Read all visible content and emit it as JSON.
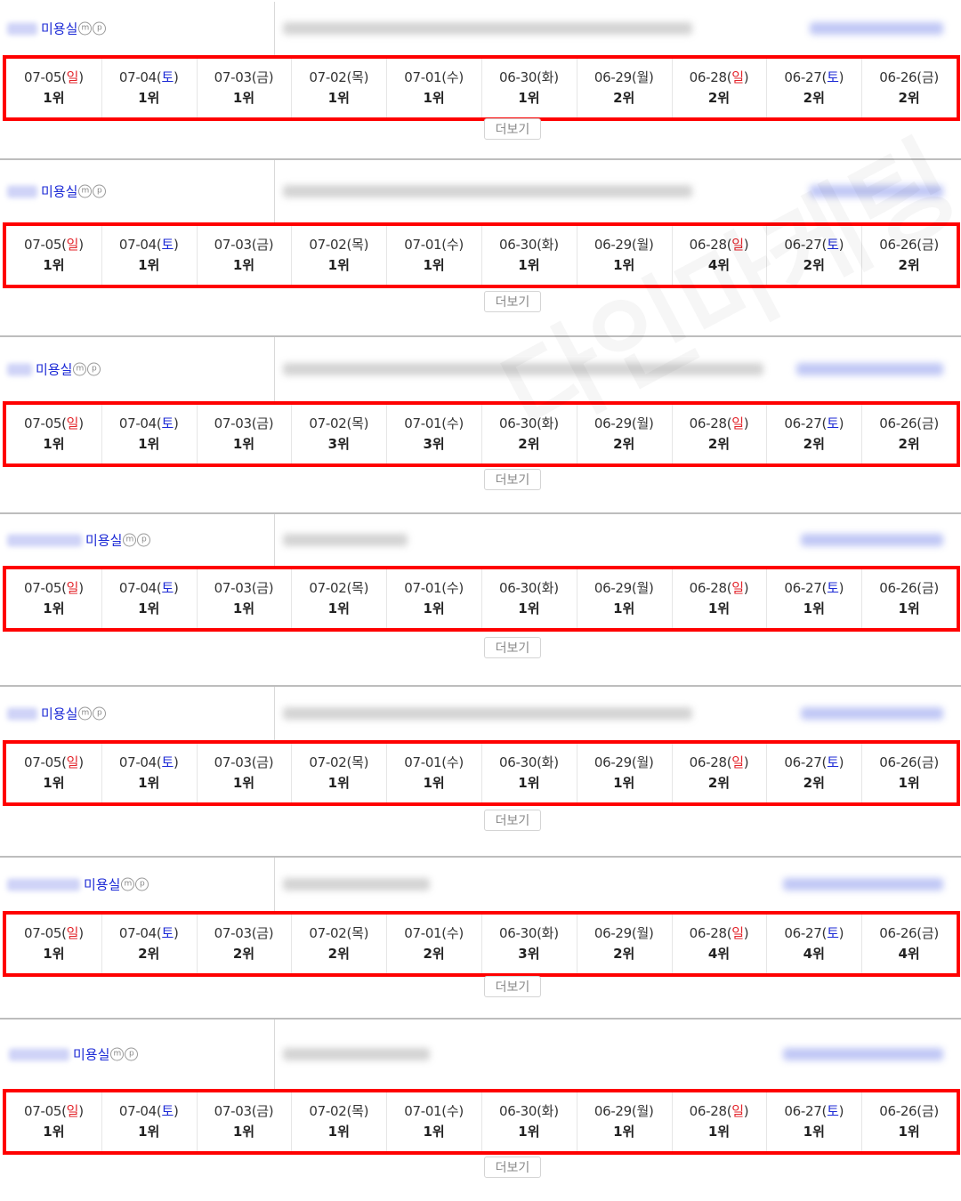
{
  "colors": {
    "accent_border": "#ff0000",
    "sunday": "#e3242b",
    "saturday": "#1c2ad6",
    "name": "#1c2ad6"
  },
  "watermark": "다인마케팅",
  "more_label": "더보기",
  "badges": {
    "mobile": "m",
    "pc": "p"
  },
  "days": [
    {
      "date": "07-05",
      "dow": "일",
      "type": "sun"
    },
    {
      "date": "07-04",
      "dow": "토",
      "type": "sat"
    },
    {
      "date": "07-03",
      "dow": "금",
      "type": "wk"
    },
    {
      "date": "07-02",
      "dow": "목",
      "type": "wk"
    },
    {
      "date": "07-01",
      "dow": "수",
      "type": "wk"
    },
    {
      "date": "06-30",
      "dow": "화",
      "type": "wk"
    },
    {
      "date": "06-29",
      "dow": "월",
      "type": "wk"
    },
    {
      "date": "06-28",
      "dow": "일",
      "type": "sun"
    },
    {
      "date": "06-27",
      "dow": "토",
      "type": "sat"
    },
    {
      "date": "06-26",
      "dow": "금",
      "type": "wk"
    }
  ],
  "rows": [
    {
      "shop_name": "미용실",
      "ranks": [
        "1위",
        "1위",
        "1위",
        "1위",
        "1위",
        "1위",
        "2위",
        "2위",
        "2위",
        "2위"
      ]
    },
    {
      "shop_name": "미용실",
      "ranks": [
        "1위",
        "1위",
        "1위",
        "1위",
        "1위",
        "1위",
        "1위",
        "4위",
        "2위",
        "2위"
      ]
    },
    {
      "shop_name": "미용실",
      "ranks": [
        "1위",
        "1위",
        "1위",
        "3위",
        "3위",
        "2위",
        "2위",
        "2위",
        "2위",
        "2위"
      ]
    },
    {
      "shop_name": "미용실",
      "ranks": [
        "1위",
        "1위",
        "1위",
        "1위",
        "1위",
        "1위",
        "1위",
        "1위",
        "1위",
        "1위"
      ]
    },
    {
      "shop_name": "미용실",
      "ranks": [
        "1위",
        "1위",
        "1위",
        "1위",
        "1위",
        "1위",
        "1위",
        "2위",
        "2위",
        "1위"
      ]
    },
    {
      "shop_name": "미용실",
      "ranks": [
        "1위",
        "2위",
        "2위",
        "2위",
        "2위",
        "3위",
        "2위",
        "4위",
        "4위",
        "4위"
      ]
    },
    {
      "shop_name": "미용실",
      "ranks": [
        "1위",
        "1위",
        "1위",
        "1위",
        "1위",
        "1위",
        "1위",
        "1위",
        "1위",
        "1위"
      ]
    }
  ]
}
